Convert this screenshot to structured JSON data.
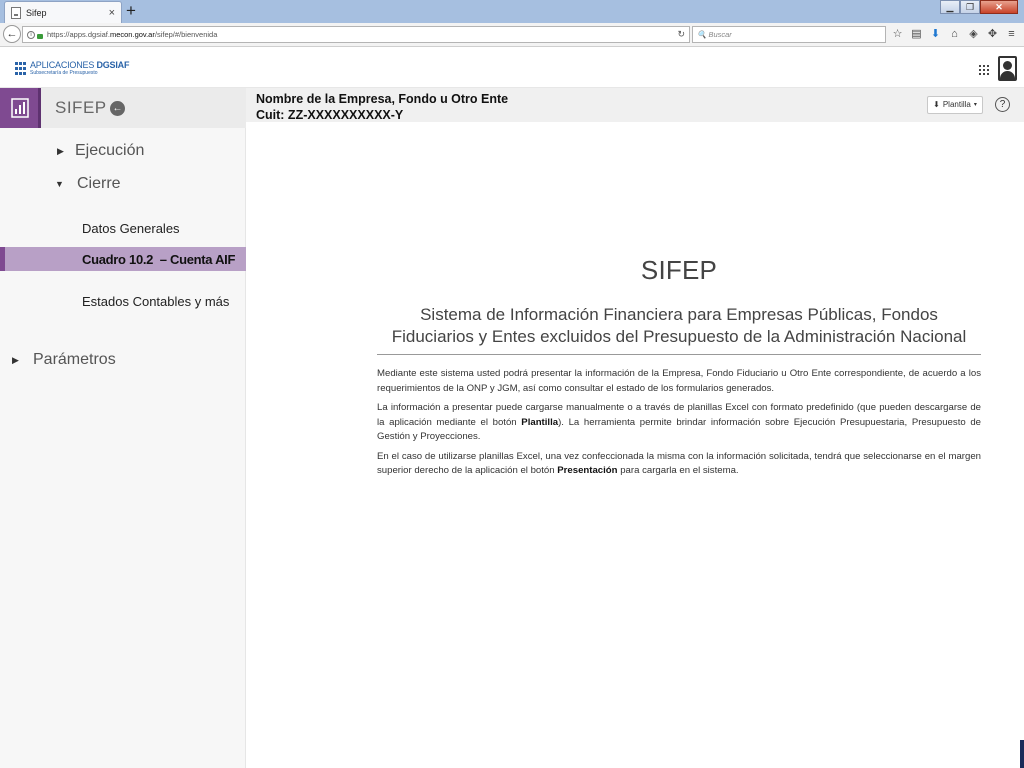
{
  "browser": {
    "tab_title": "Sifep",
    "url_prefix": "https://apps.dgsiaf.",
    "url_host": "mecon.gov.ar",
    "url_path": "/sifep/#/bienvenida",
    "search_placeholder": "Buscar"
  },
  "header": {
    "logo_main": "APLICACIONES",
    "logo_brand": "DGSIAF",
    "logo_sub": "Subsecretaría de Presupuesto"
  },
  "sidebar": {
    "title": "SIFEP",
    "items": [
      {
        "label": "Ejecución"
      },
      {
        "label": "Cierre"
      },
      {
        "label": "Datos Generales"
      },
      {
        "label": "Cuadro 10.2  – Cuenta AIF"
      },
      {
        "label": "Estados Contables y más"
      },
      {
        "label": "Parámetros"
      }
    ]
  },
  "context": {
    "entity_name": "Nombre de la Empresa, Fondo u Otro Ente",
    "entity_cuit": "Cuit: ZZ-XXXXXXXXXX-Y",
    "plantilla_label": "Plantilla"
  },
  "welcome": {
    "title": "SIFEP",
    "subtitle": "Sistema de Información Financiera para Empresas Públicas, Fondos Fiduciarios y Entes excluidos del Presupuesto de la Administración Nacional",
    "p1": "Mediante este sistema usted podrá presentar la información de la Empresa, Fondo Fiduciario u Otro Ente correspondiente, de acuerdo a los requerimientos de la ONP y JGM, así como consultar el estado de los formularios generados.",
    "p2_a": "La información a presentar puede cargarse manualmente o a través de planillas Excel con formato predefinido (que pueden descargarse de la aplicación mediante el botón ",
    "p2_b": "Plantilla",
    "p2_c": "). La herramienta permite brindar información sobre Ejecución Presupuestaria, Presupuesto de Gestión y Proyecciones.",
    "p3_a": "En el caso de utilizarse planillas Excel, una vez confeccionada la misma con la información solicitada, tendrá que seleccionarse en el margen superior derecho de la aplicación el botón ",
    "p3_b": "Presentación",
    "p3_c": " para cargarla en el sistema."
  },
  "colors": {
    "accent_purple": "#7f4a91",
    "active_item_bg": "#b8a0c6",
    "brand_blue": "#2a63a8"
  },
  "icons": {
    "sidebar_module": "bar-chart-icon",
    "back": "arrow-left-circle-icon",
    "help": "question-circle-icon"
  }
}
